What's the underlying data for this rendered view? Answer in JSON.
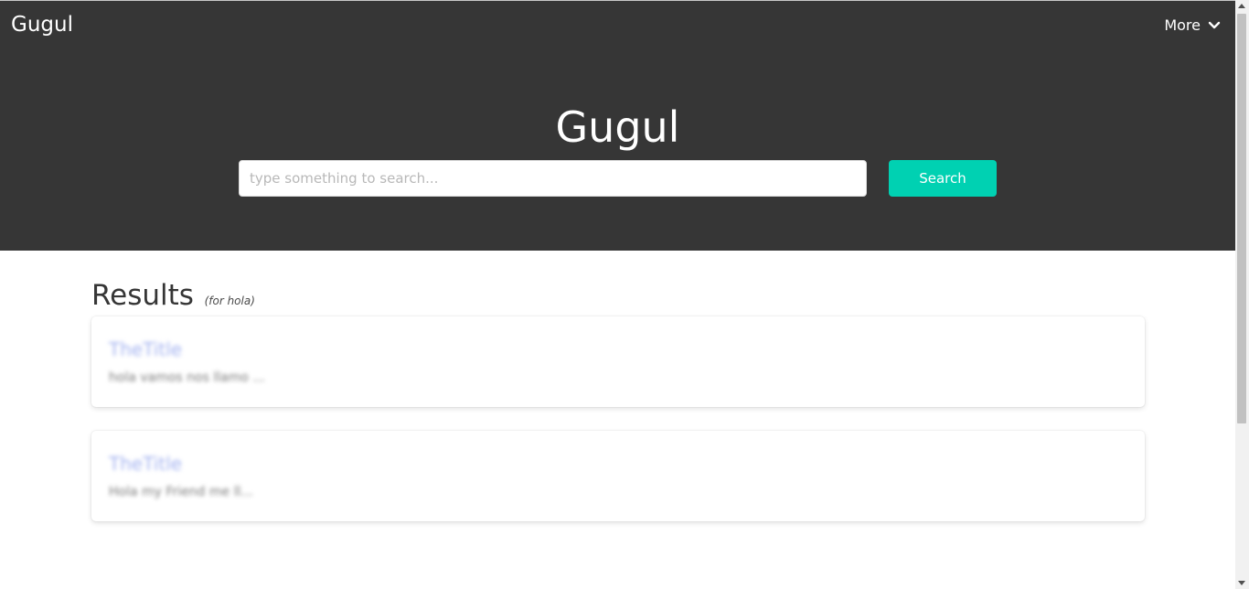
{
  "navbar": {
    "brand": "Gugul",
    "more_label": "More",
    "more_icon": "chevron-down-icon"
  },
  "hero": {
    "title": "Gugul",
    "search": {
      "placeholder": "type something to search...",
      "value": "",
      "button_label": "Search"
    }
  },
  "results": {
    "heading": "Results",
    "for_prefix": "(for ",
    "query": "hola",
    "for_suffix": ")",
    "items": [
      {
        "title": "TheTitle",
        "snippet": "hola vamos nos llamo ..."
      },
      {
        "title": "TheTitle",
        "snippet": "Hola my Friend me ll..."
      }
    ]
  },
  "colors": {
    "header_bg": "#363636",
    "accent": "#00d1b2",
    "link": "#a4b3f0"
  }
}
